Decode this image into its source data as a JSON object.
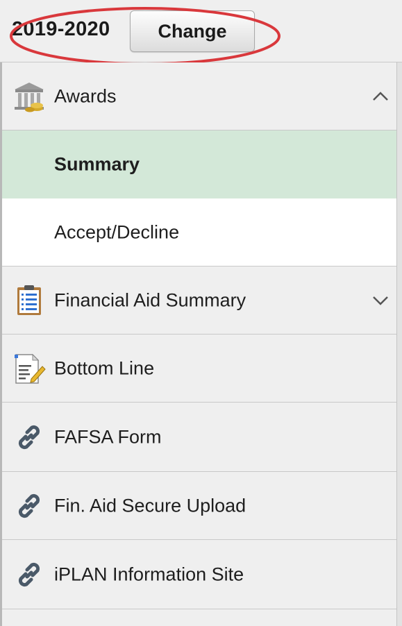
{
  "header": {
    "year": "2019-2020",
    "change_label": "Change"
  },
  "nav": {
    "awards": {
      "label": "Awards",
      "icon": "bank-icon",
      "expanded": true
    },
    "summary": {
      "label": "Summary",
      "selected": true
    },
    "accept_decline": {
      "label": "Accept/Decline"
    },
    "financial_aid_summary": {
      "label": "Financial Aid Summary",
      "icon": "clipboard-icon",
      "expanded": false
    },
    "bottom_line": {
      "label": "Bottom Line",
      "icon": "document-edit-icon"
    },
    "fafsa_form": {
      "label": "FAFSA Form",
      "icon": "link-icon"
    },
    "secure_upload": {
      "label": "Fin. Aid Secure Upload",
      "icon": "link-icon"
    },
    "iplan": {
      "label": "iPLAN Information Site",
      "icon": "link-icon"
    }
  },
  "colors": {
    "selected_row": "#d3e8d8",
    "highlight_ring": "#d9383c",
    "link_icon": "#4a5968"
  }
}
